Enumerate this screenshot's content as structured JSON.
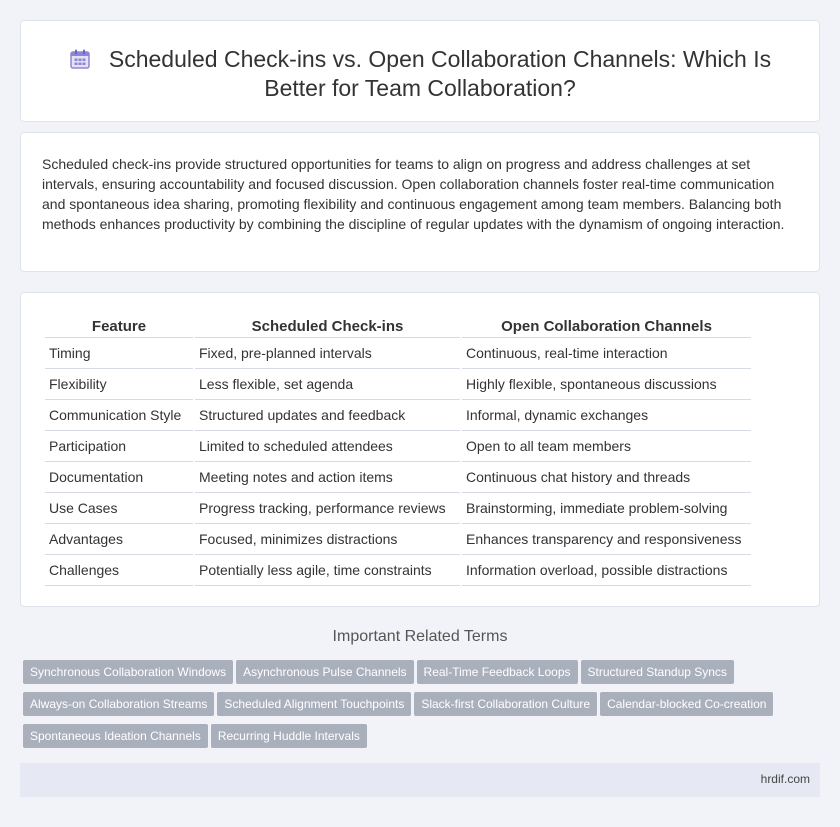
{
  "header": {
    "title": "Scheduled Check-ins vs. Open Collaboration Channels: Which Is Better for Team Collaboration?",
    "icon": "calendar-icon"
  },
  "intro": {
    "text": "Scheduled check-ins provide structured opportunities for teams to align on progress and address challenges at set intervals, ensuring accountability and focused discussion. Open collaboration channels foster real-time communication and spontaneous idea sharing, promoting flexibility and continuous engagement among team members. Balancing both methods enhances productivity by combining the discipline of regular updates with the dynamism of ongoing interaction."
  },
  "table": {
    "headers": [
      "Feature",
      "Scheduled Check-ins",
      "Open Collaboration Channels"
    ],
    "rows": [
      [
        "Timing",
        "Fixed, pre-planned intervals",
        "Continuous, real-time interaction"
      ],
      [
        "Flexibility",
        "Less flexible, set agenda",
        "Highly flexible, spontaneous discussions"
      ],
      [
        "Communication Style",
        "Structured updates and feedback",
        "Informal, dynamic exchanges"
      ],
      [
        "Participation",
        "Limited to scheduled attendees",
        "Open to all team members"
      ],
      [
        "Documentation",
        "Meeting notes and action items",
        "Continuous chat history and threads"
      ],
      [
        "Use Cases",
        "Progress tracking, performance reviews",
        "Brainstorming, immediate problem-solving"
      ],
      [
        "Advantages",
        "Focused, minimizes distractions",
        "Enhances transparency and responsiveness"
      ],
      [
        "Challenges",
        "Potentially less agile, time constraints",
        "Information overload, possible distractions"
      ]
    ]
  },
  "related": {
    "heading": "Important Related Terms",
    "tags": [
      "Synchronous Collaboration Windows",
      "Asynchronous Pulse Channels",
      "Real-Time Feedback Loops",
      "Structured Standup Syncs",
      "Always-on Collaboration Streams",
      "Scheduled Alignment Touchpoints",
      "Slack-first Collaboration Culture",
      "Calendar-blocked Co-creation",
      "Spontaneous Ideation Channels",
      "Recurring Huddle Intervals"
    ]
  },
  "footer": {
    "site": "hrdif.com"
  }
}
